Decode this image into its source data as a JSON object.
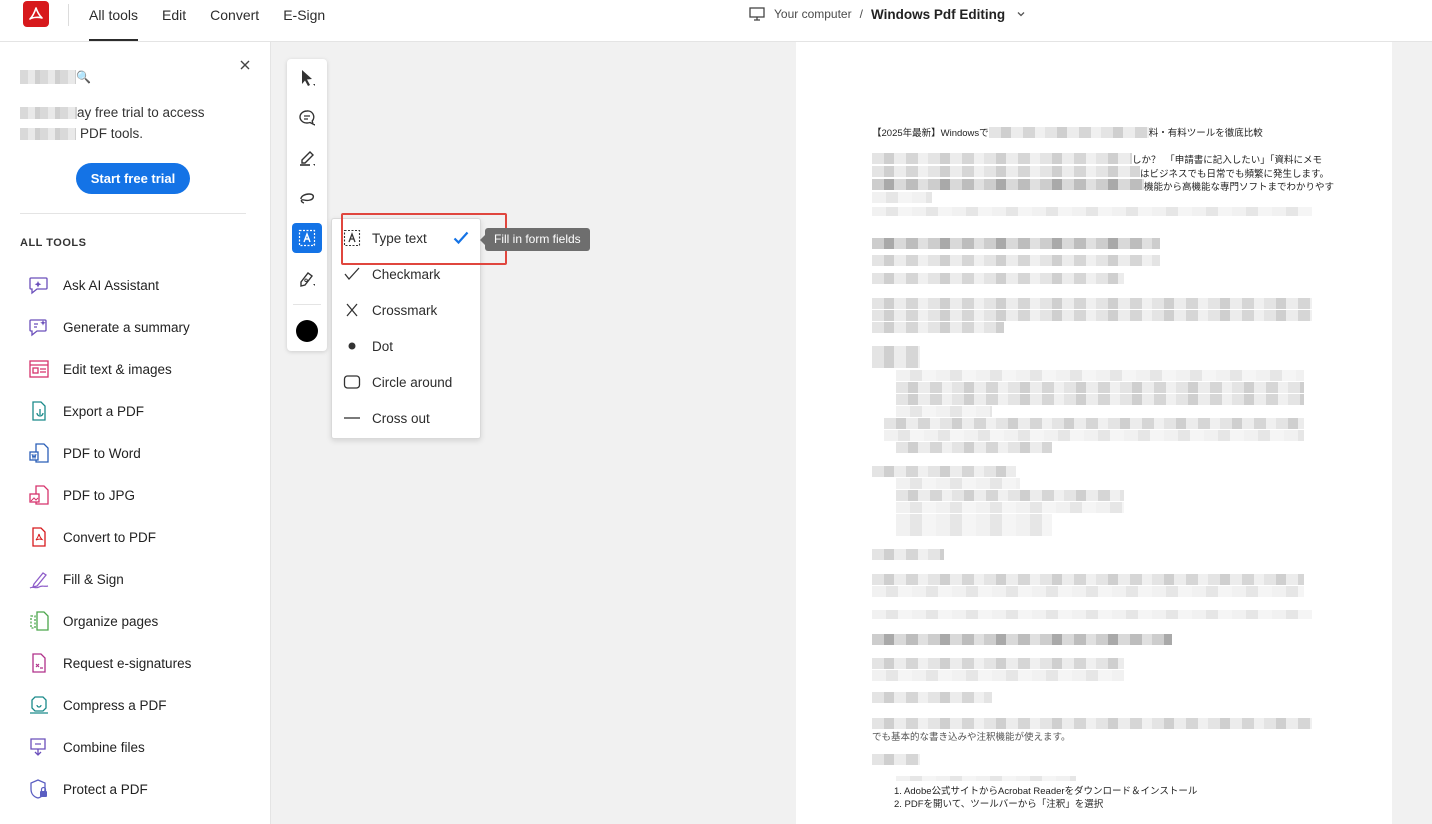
{
  "topbar": {
    "nav": [
      {
        "label": "All tools",
        "active": true
      },
      {
        "label": "Edit",
        "active": false
      },
      {
        "label": "Convert",
        "active": false
      },
      {
        "label": "E-Sign",
        "active": false
      }
    ],
    "location": "Your computer",
    "separator": "/",
    "filename": "Windows Pdf Editing"
  },
  "promo": {
    "line1_suffix": "ay free trial to access",
    "line2_suffix": "PDF tools.",
    "button": "Start free trial"
  },
  "sidebar": {
    "heading": "ALL TOOLS",
    "items": [
      {
        "label": "Ask AI Assistant",
        "icon": "ai-assistant-icon"
      },
      {
        "label": "Generate a summary",
        "icon": "summary-icon"
      },
      {
        "label": "Edit text & images",
        "icon": "edit-text-icon"
      },
      {
        "label": "Export a PDF",
        "icon": "export-pdf-icon"
      },
      {
        "label": "PDF to Word",
        "icon": "pdf-to-word-icon"
      },
      {
        "label": "PDF to JPG",
        "icon": "pdf-to-jpg-icon"
      },
      {
        "label": "Convert to PDF",
        "icon": "convert-to-pdf-icon"
      },
      {
        "label": "Fill & Sign",
        "icon": "fill-sign-icon"
      },
      {
        "label": "Organize pages",
        "icon": "organize-pages-icon"
      },
      {
        "label": "Request e-signatures",
        "icon": "request-esign-icon"
      },
      {
        "label": "Compress a PDF",
        "icon": "compress-pdf-icon"
      },
      {
        "label": "Combine files",
        "icon": "combine-files-icon"
      },
      {
        "label": "Protect a PDF",
        "icon": "protect-pdf-icon"
      }
    ]
  },
  "fill_menu": {
    "items": [
      {
        "label": "Type text",
        "selected": true
      },
      {
        "label": "Checkmark",
        "selected": false
      },
      {
        "label": "Crossmark",
        "selected": false
      },
      {
        "label": "Dot",
        "selected": false
      },
      {
        "label": "Circle around",
        "selected": false
      },
      {
        "label": "Cross out",
        "selected": false
      }
    ],
    "tooltip": "Fill in form fields"
  },
  "document": {
    "title_start": "【2025年最新】Windowsで",
    "title_end": "料・有料ツールを徹底比較",
    "p1_l1_end": "しか？　「申請書に記入したい」「資料にメモ",
    "p1_l2_end": "はビジネスでも日常でも頻繁に発生します。",
    "p1_l3_end": "機能から高機能な専門ソフトまでわかりやす",
    "partial_line": "でも基本的な書き込みや注釈機能が使えます。",
    "step1": "1. Adobe公式サイトからAcrobat Readerをダウンロード＆インストール",
    "step2": "2. PDFを開いて、ツールバーから「注釈」を選択"
  },
  "colors": {
    "accent": "#1473e6",
    "logo": "#d7191c",
    "highlight": "#e0463e",
    "active_color_swatch": "#000000"
  }
}
